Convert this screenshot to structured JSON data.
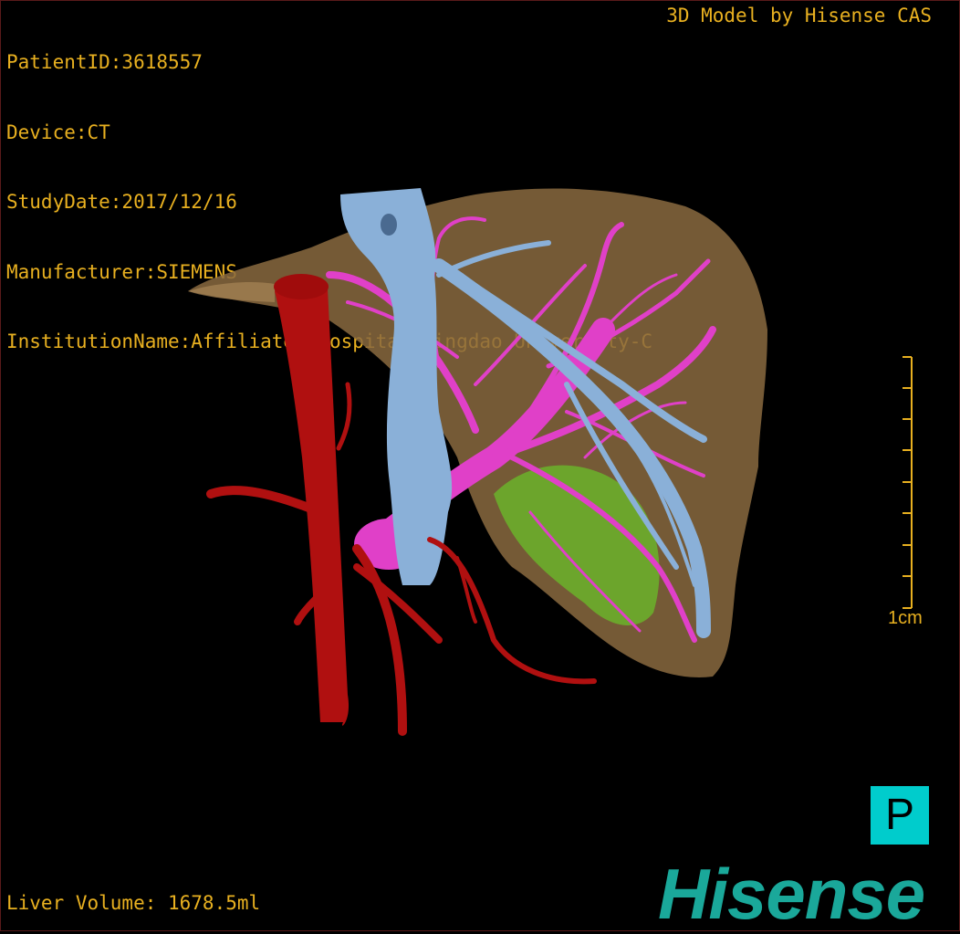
{
  "header": {
    "patient_id": "PatientID:3618557",
    "device": "Device:CT",
    "study_date": "StudyDate:2017/12/16",
    "manufacturer": "Manufacturer:SIEMENS",
    "institution": "InstitutionName:Affiliated Hospital Qingdao University-C"
  },
  "credit": "3D Model by Hisense CAS",
  "footer": {
    "liver_volume": "Liver Volume: 1678.5ml"
  },
  "scale_bar": {
    "label": "1cm"
  },
  "orientation_marker": "P",
  "logo_text": "Hisense",
  "colors": {
    "overlay_text": "#e8b020",
    "liver": "#8a6a40",
    "hepatic_vein": "#8ab0d8",
    "portal_vein": "#e040c8",
    "artery": "#b01010",
    "lesion": "#6abf2a",
    "orientation_bg": "#00cccc",
    "logo": "#1aa89a"
  }
}
